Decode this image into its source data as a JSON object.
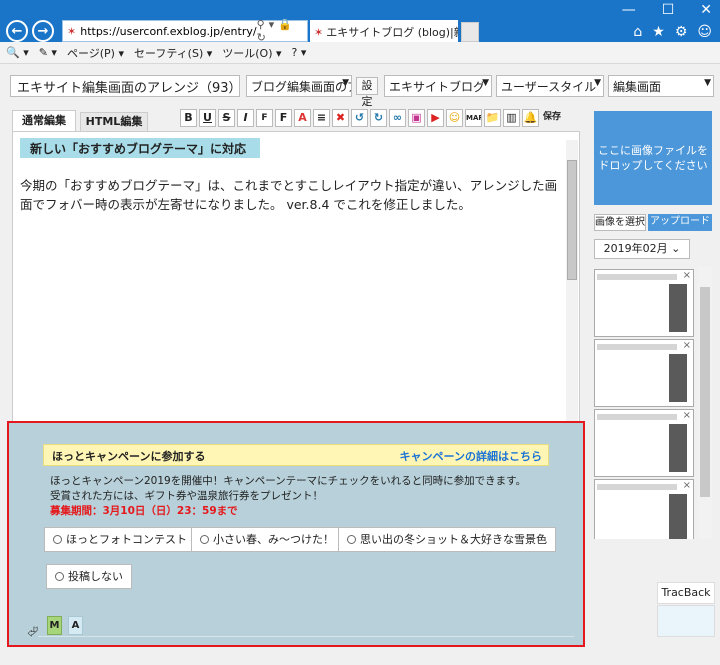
{
  "browser": {
    "url_host": "https://userconf.exblog.jp/entry/",
    "tab_title": "エキサイトブログ (blog)|新規投...",
    "tab_close": "×",
    "window_controls": [
      "—",
      "☐",
      "✕"
    ],
    "right_icons": [
      "⌂",
      "★",
      "⚙",
      "☺"
    ],
    "nav_back": "←",
    "nav_forward": "→",
    "cmd": [
      "🔍 ▾",
      "✎ ▾",
      "ページ(P) ▾",
      "セーフティ(S) ▾",
      "ツール(O) ▾",
      "? ▾"
    ]
  },
  "editor_header": {
    "title_value": "エキサイト編集画面のアレンジ（93）",
    "category": "ブログ編集画面のア",
    "settings_label": "設定",
    "select_blog": "エキサイトブログ",
    "select_user_style": "ユーザースタイル",
    "select_screen": "編集画面"
  },
  "tabs": {
    "normal": "通常編集",
    "html": "HTML編集"
  },
  "format_buttons": [
    "B",
    "U",
    "S",
    "I",
    "F",
    "F",
    "A",
    "≡",
    "✖",
    "↺",
    "↻",
    "∞",
    "▣",
    "▶",
    "☺",
    "MAP",
    "📁",
    "▥",
    "🔔",
    "保存"
  ],
  "content": {
    "heading": "新しい「おすすめブログテーマ」に対応",
    "body": "今期の「おすすめブログテーマ」は、これまでとすこしレイアウト指定が違い、アレンジした画面でフォバー時の表示が左寄せになりました。 ver.8.4 でこれを修正しました。"
  },
  "campaign": {
    "header": "ほっとキャンペーンに参加する",
    "link": "キャンペーンの詳細はこちら",
    "desc1": "ほっとキャンペーン2019を開催中！キャンペーンテーマにチェックをいれると同時に参加できます。",
    "desc2": "受賞された方には、ギフト券や温泉旅行券をプレゼント！",
    "date": "募集期間：3月10日（日）23：59まで",
    "options": [
      "ほっとフォトコンテスト",
      "小さい春、み〜つけた！",
      "思い出の冬ショット＆大好きな雪景色",
      "投稿しない"
    ],
    "m_label": "M",
    "a_label": "A"
  },
  "sidebar": {
    "drop_line1": "ここに画像ファイルを",
    "drop_line2": "ドロップしてください",
    "pick": "画像を選択",
    "upload": "アップロード",
    "month": "2019年02月 ⌄",
    "thumbnail_close": "×",
    "trackback": "TracBack"
  }
}
